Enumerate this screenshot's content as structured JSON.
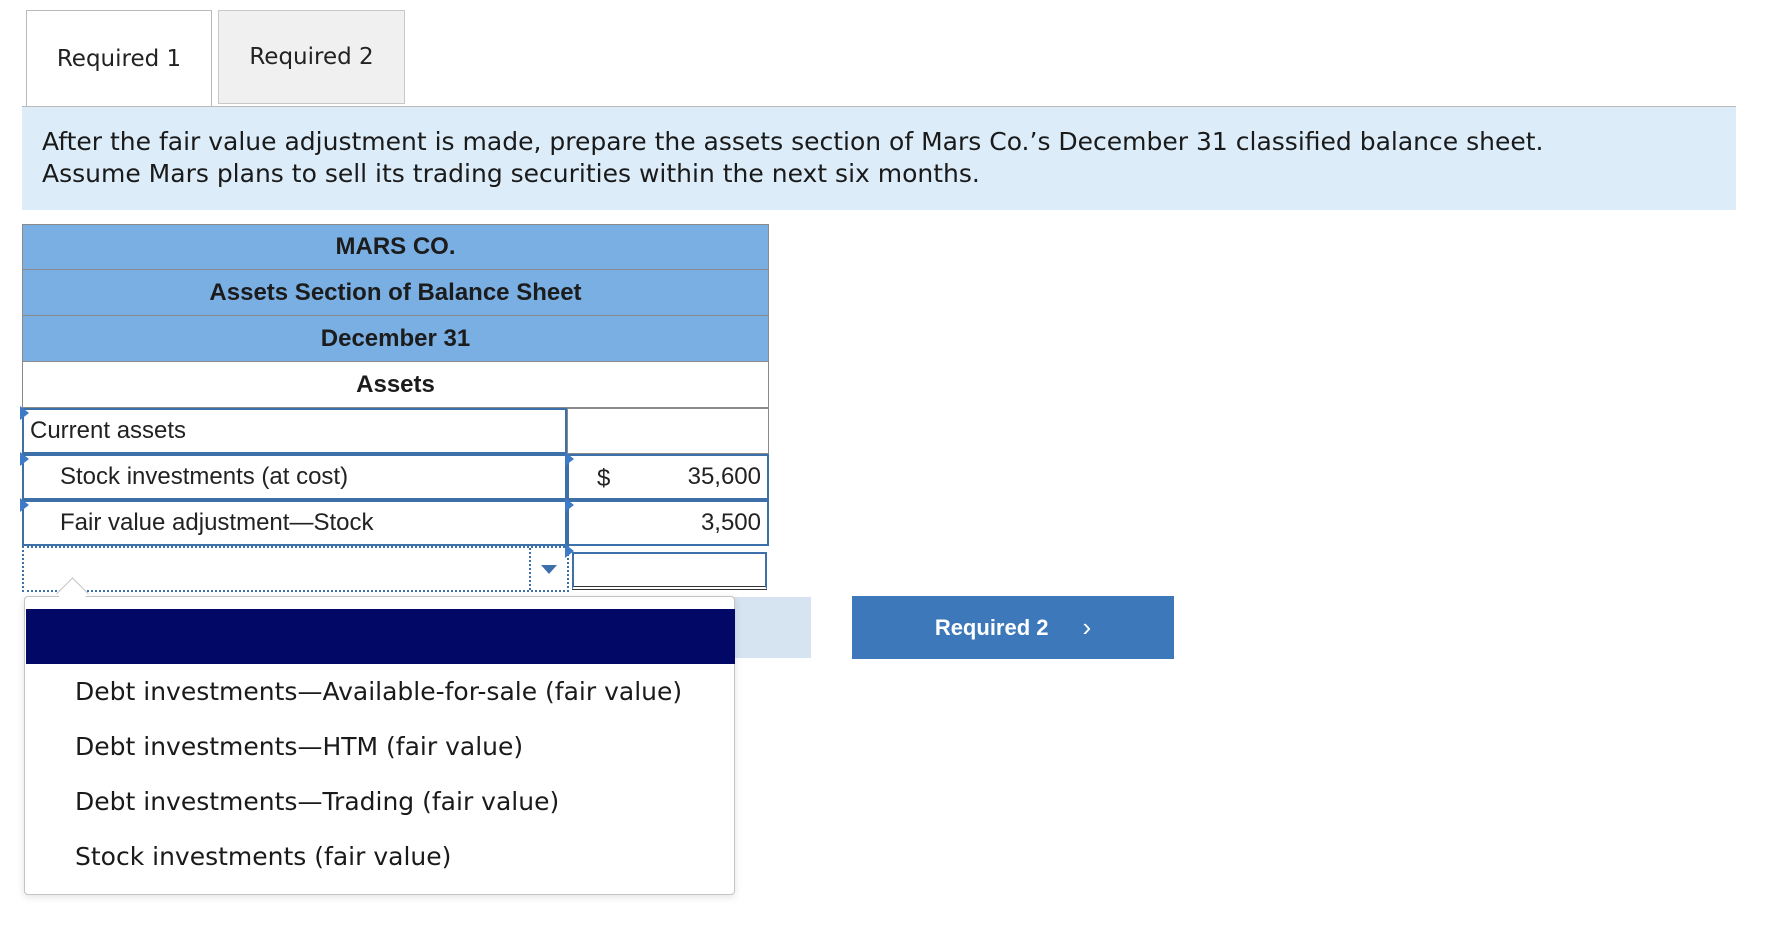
{
  "tabs": [
    {
      "label": "Required 1",
      "active": true
    },
    {
      "label": "Required 2",
      "active": false
    }
  ],
  "instructions": {
    "line1": "After the fair value adjustment is made, prepare the assets section of Mars Co.’s December 31 classified balance sheet.",
    "line2": "Assume Mars plans to sell its trading securities within the next six months."
  },
  "sheet": {
    "company": "MARS CO.",
    "title": "Assets Section of Balance Sheet",
    "date": "December 31",
    "section": "Assets",
    "rows": [
      {
        "label": "Current assets",
        "amount": ""
      },
      {
        "label": "Stock investments (at cost)",
        "currency": "$",
        "amount": "35,600"
      },
      {
        "label": "Fair value adjustment—Stock",
        "amount": "3,500"
      }
    ]
  },
  "dropdown": {
    "selected": "",
    "options": [
      "Debt investments—Available-for-sale (fair value)",
      "Debt investments—HTM (fair value)",
      "Debt investments—Trading (fair value)",
      "Stock investments (fair value)"
    ]
  },
  "nav": {
    "next_label": "Required 2",
    "next_chevron": "›"
  },
  "colors": {
    "header_blue": "#7aafe3",
    "instruction_bg": "#dcedf9",
    "button_blue": "#3d79ba",
    "highlight_navy": "#010866"
  }
}
